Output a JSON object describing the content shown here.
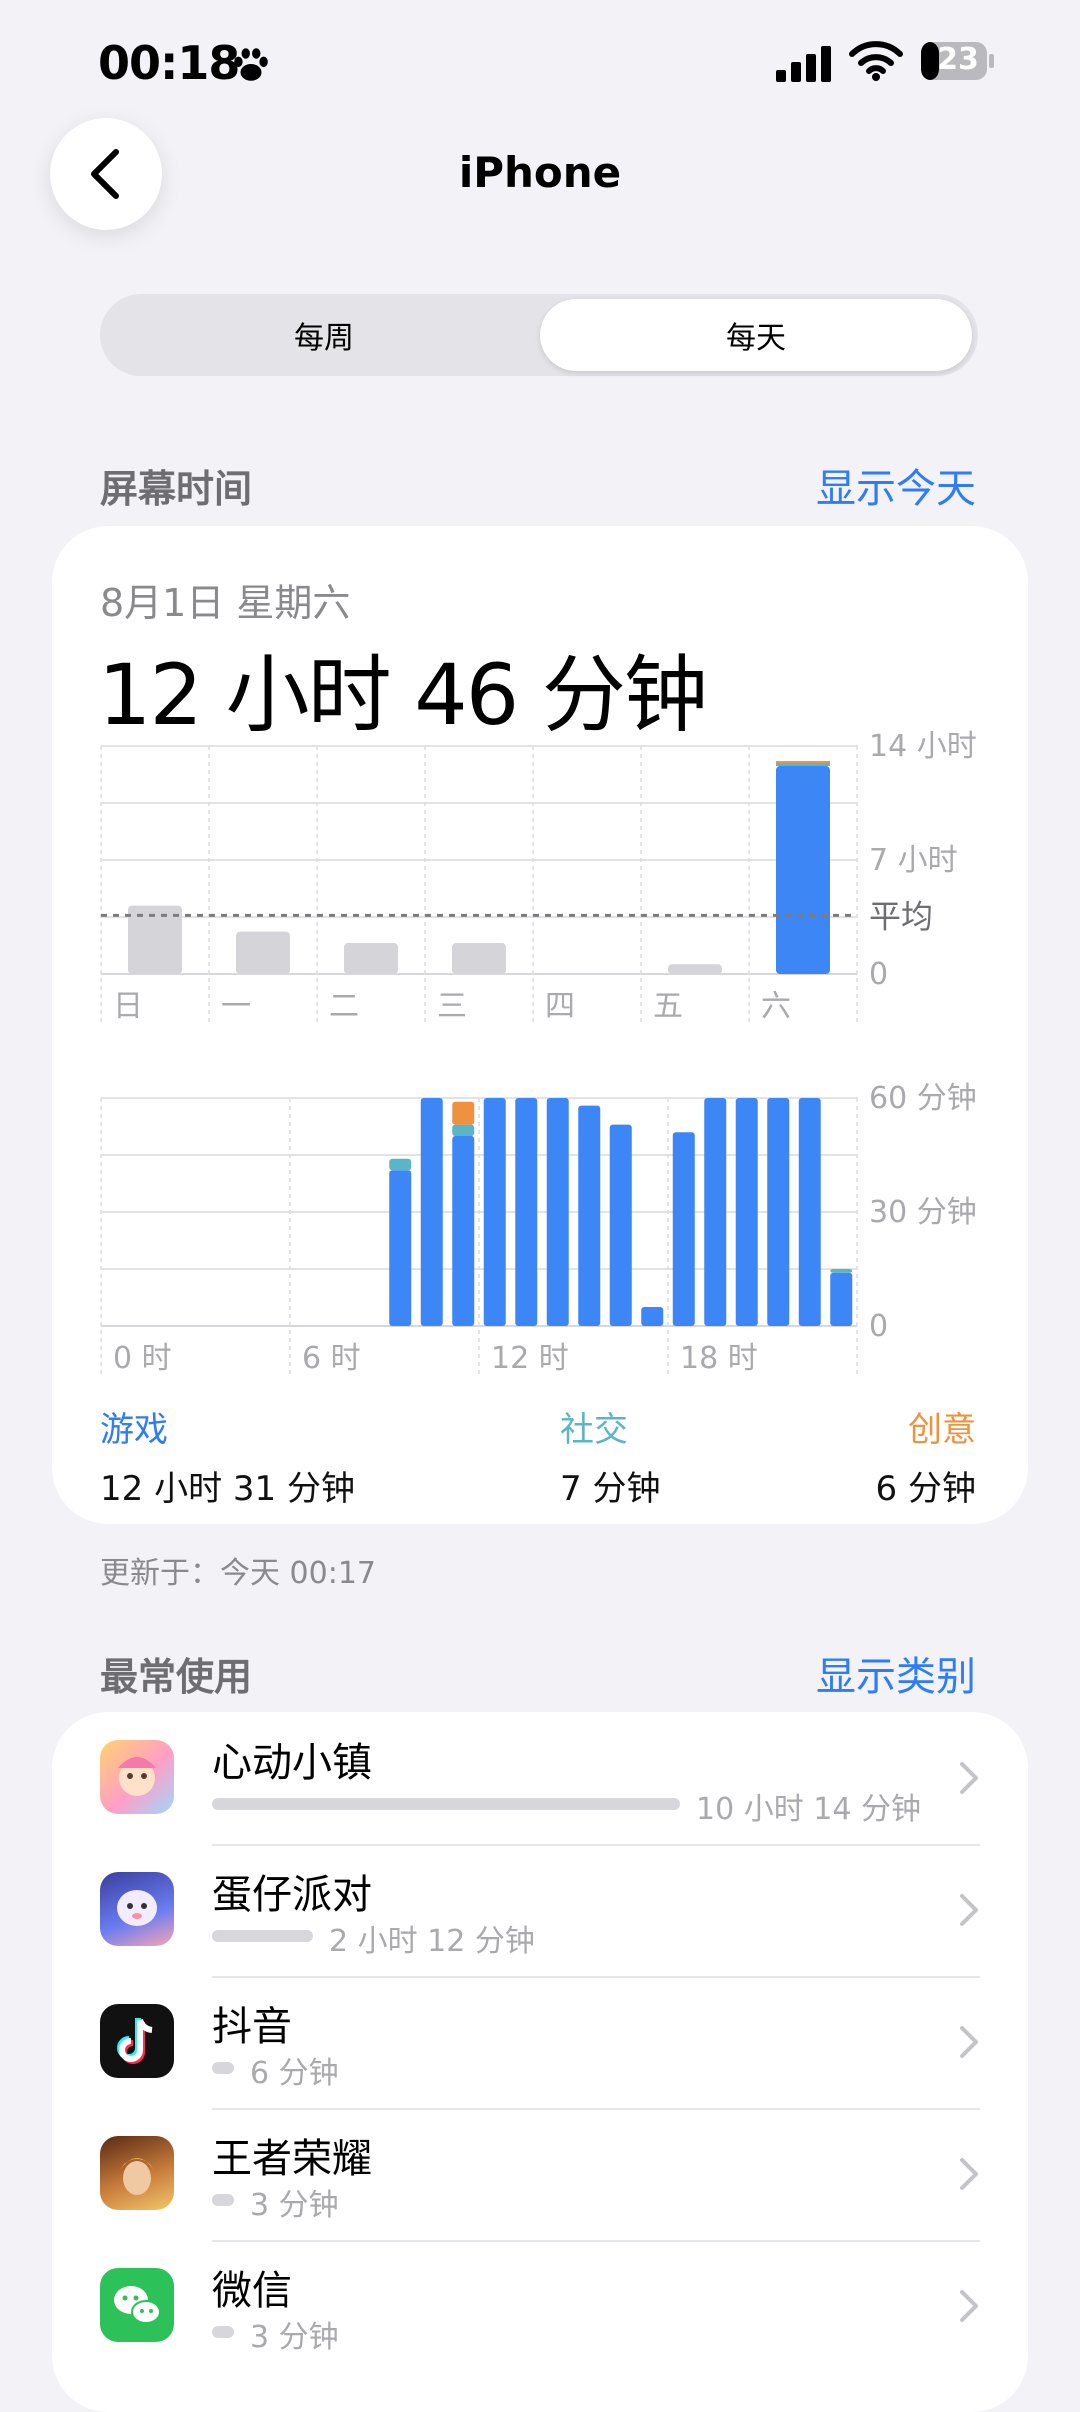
{
  "status": {
    "time": "00:18",
    "battery": "23"
  },
  "nav": {
    "title": "iPhone"
  },
  "segmented": {
    "weekly": "每周",
    "daily": "每天",
    "selected": "每天"
  },
  "screen_time": {
    "section_title": "屏幕时间",
    "link": "显示今天",
    "date": "8月1日 星期六",
    "total": "12 小时 46 分钟",
    "categories": [
      {
        "name": "游戏",
        "value": "12 小时 31 分钟",
        "color": "#2f7df6"
      },
      {
        "name": "社交",
        "value": "7 分钟",
        "color": "#5ab6c7"
      },
      {
        "name": "创意",
        "value": "6 分钟",
        "color": "#ef9240"
      }
    ],
    "updated": "更新于：今天 00:17"
  },
  "chart_data": [
    {
      "type": "bar",
      "categories": [
        "日",
        "一",
        "二",
        "三",
        "四",
        "五",
        "六"
      ],
      "values_hours": [
        4.2,
        2.6,
        1.9,
        1.9,
        0,
        0.6,
        12.77
      ],
      "highlight_index": 6,
      "average_hours": 3.6,
      "y_ticks": [
        "14 小时",
        "7 小时",
        "0"
      ],
      "average_label": "平均",
      "ylim": [
        0,
        14
      ],
      "colors": {
        "inactive": "#d4d4d9",
        "highlight": "#3d86f5",
        "social": "#5ab6c7",
        "creative": "#ef9240"
      }
    },
    {
      "type": "bar",
      "stacked": true,
      "x_ticks": [
        "0 时",
        "6 时",
        "12 时",
        "18 时"
      ],
      "y_ticks": [
        "60 分钟",
        "30 分钟",
        "0"
      ],
      "ylim": [
        0,
        60
      ],
      "hours": [
        0,
        1,
        2,
        3,
        4,
        5,
        6,
        7,
        8,
        9,
        10,
        11,
        12,
        13,
        14,
        15,
        16,
        17,
        18,
        19,
        20,
        21,
        22,
        23
      ],
      "series": [
        {
          "name": "游戏",
          "values": [
            0,
            0,
            0,
            0,
            0,
            0,
            0,
            0,
            0,
            41,
            60,
            50,
            60,
            60,
            60,
            58,
            53,
            5,
            51,
            60,
            60,
            60,
            60,
            14
          ],
          "color": "#3d86f5"
        },
        {
          "name": "社交",
          "values": [
            0,
            0,
            0,
            0,
            0,
            0,
            0,
            0,
            0,
            3,
            0,
            3,
            0,
            0,
            0,
            0,
            0,
            0,
            0,
            0,
            0,
            0,
            0,
            1
          ],
          "color": "#5ab6c7"
        },
        {
          "name": "创意",
          "values": [
            0,
            0,
            0,
            0,
            0,
            0,
            0,
            0,
            0,
            0,
            0,
            6,
            0,
            0,
            0,
            0,
            0,
            0,
            0,
            0,
            0,
            0,
            0,
            0
          ],
          "color": "#ef9240"
        }
      ]
    }
  ],
  "most_used": {
    "section_title": "最常使用",
    "link": "显示类别",
    "apps": [
      {
        "name": "心动小镇",
        "time": "10 小时 14 分钟",
        "minutes": 614,
        "icon": "xindong-town-icon"
      },
      {
        "name": "蛋仔派对",
        "time": "2 小时 12 分钟",
        "minutes": 132,
        "icon": "eggy-party-icon"
      },
      {
        "name": "抖音",
        "time": "6 分钟",
        "minutes": 6,
        "icon": "douyin-icon"
      },
      {
        "name": "王者荣耀",
        "time": "3 分钟",
        "minutes": 3,
        "icon": "honor-of-kings-icon"
      },
      {
        "name": "微信",
        "time": "3 分钟",
        "minutes": 3,
        "icon": "wechat-icon"
      }
    ]
  }
}
